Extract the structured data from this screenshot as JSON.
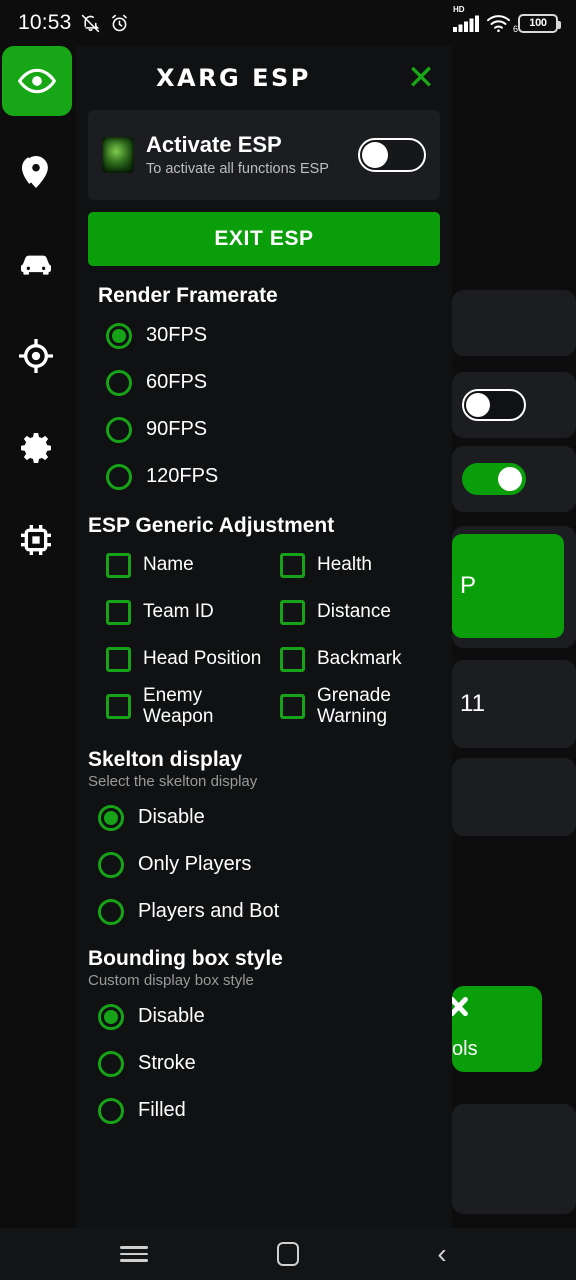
{
  "statusbar": {
    "time": "10:53",
    "icons_left": [
      "mute-icon",
      "alarm-icon"
    ],
    "network_label": "HD",
    "wifi_generation": "6",
    "battery_level": "100"
  },
  "colors": {
    "accent_green": "#0a9e0a",
    "radio_green": "#17a317",
    "panel_bg": "#101112",
    "card_bg": "#1b1d21",
    "screen_bg": "#0d0d0d"
  },
  "header": {
    "title": "XARG ESP",
    "close_label": "✕"
  },
  "rail": {
    "items": [
      {
        "name": "eye-icon",
        "label": "ESP",
        "active": true
      },
      {
        "name": "location-pin-icon",
        "label": "Location",
        "active": false
      },
      {
        "name": "car-icon",
        "label": "Vehicle",
        "active": false
      },
      {
        "name": "target-icon",
        "label": "Aim",
        "active": false
      },
      {
        "name": "gear-icon",
        "label": "Settings",
        "active": false
      },
      {
        "name": "chip-icon",
        "label": "Memory",
        "active": false
      }
    ]
  },
  "activate_card": {
    "title": "Activate ESP",
    "subtitle": "To activate all functions ESP",
    "toggle_state": "off"
  },
  "exit_button": {
    "label": "EXIT ESP"
  },
  "render_framerate": {
    "title": "Render Framerate",
    "options": [
      {
        "label": "30FPS",
        "selected": true
      },
      {
        "label": "60FPS",
        "selected": false
      },
      {
        "label": "90FPS",
        "selected": false
      },
      {
        "label": "120FPS",
        "selected": false
      }
    ]
  },
  "esp_generic": {
    "title": "ESP Generic Adjustment",
    "options": [
      {
        "label": "Name",
        "checked": false
      },
      {
        "label": "Health",
        "checked": false
      },
      {
        "label": "Team ID",
        "checked": false
      },
      {
        "label": "Distance",
        "checked": false
      },
      {
        "label": "Head Position",
        "checked": false
      },
      {
        "label": "Backmark",
        "checked": false
      },
      {
        "label": "Enemy Weapon",
        "checked": false
      },
      {
        "label": "Grenade Warning",
        "checked": false
      }
    ]
  },
  "skelton_display": {
    "title": "Skelton display",
    "subtitle": "Select the skelton display",
    "options": [
      {
        "label": "Disable",
        "selected": true
      },
      {
        "label": "Only Players",
        "selected": false
      },
      {
        "label": "Players and Bot",
        "selected": false
      }
    ]
  },
  "bounding_box_style": {
    "title": "Bounding box style",
    "subtitle": "Custom display box style",
    "options": [
      {
        "label": "Disable",
        "selected": true
      },
      {
        "label": "Stroke",
        "selected": false
      },
      {
        "label": "Filled",
        "selected": false
      }
    ]
  },
  "background_layer": {
    "green_button_partial_text": "P",
    "partial_value_text": "11",
    "tools_partial_label": "ols"
  },
  "navbar": {
    "recents_label": "Recents",
    "home_label": "Home",
    "back_label": "Back"
  }
}
